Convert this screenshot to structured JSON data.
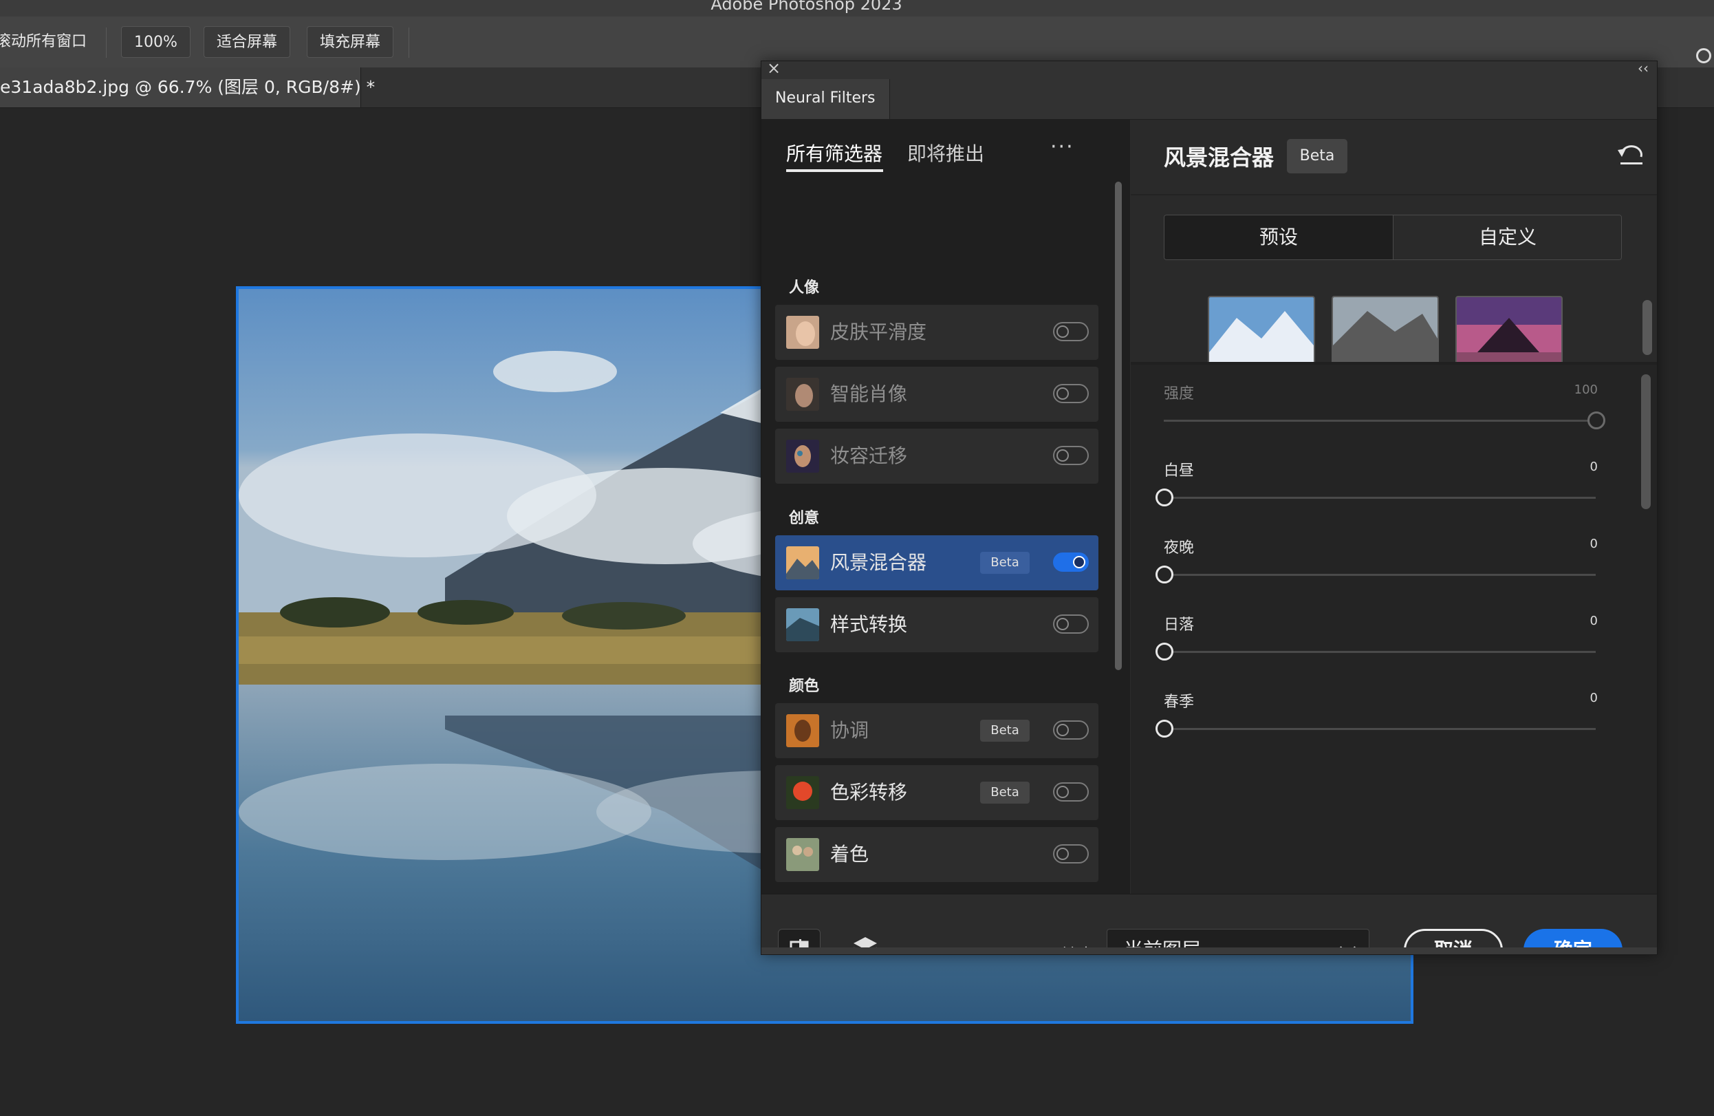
{
  "app": {
    "title": "Adobe Photoshop 2023"
  },
  "options_bar": {
    "scroll_all": "滚动所有窗口",
    "zoom": "100%",
    "fit_screen": "适合屏幕",
    "fill_screen": "填充屏幕"
  },
  "document": {
    "tab_label": "e31ada8b2.jpg @ 66.7% (图层 0, RGB/8#) *"
  },
  "neural_filters": {
    "panel_title": "Neural Filters",
    "close_glyph": "×",
    "collapse_glyph": "‹‹",
    "tabs": {
      "all": "所有筛选器",
      "upcoming": "即将推出",
      "more": "···"
    },
    "categories": [
      {
        "name": "人像",
        "filters": [
          {
            "name": "皮肤平滑度",
            "beta": false,
            "enabled": false,
            "dim": true
          },
          {
            "name": "智能肖像",
            "beta": false,
            "enabled": false,
            "dim": true
          },
          {
            "name": "妆容迁移",
            "beta": false,
            "enabled": false,
            "dim": true
          }
        ]
      },
      {
        "name": "创意",
        "filters": [
          {
            "name": "风景混合器",
            "beta": true,
            "enabled": true,
            "dim": false,
            "active": true
          },
          {
            "name": "样式转换",
            "beta": false,
            "enabled": false,
            "dim": false
          }
        ]
      },
      {
        "name": "颜色",
        "filters": [
          {
            "name": "协调",
            "beta": true,
            "enabled": false,
            "dim": true
          },
          {
            "name": "色彩转移",
            "beta": true,
            "enabled": false,
            "dim": false
          },
          {
            "name": "着色",
            "beta": false,
            "enabled": false,
            "dim": false
          }
        ]
      }
    ],
    "beta_label": "Beta",
    "detail": {
      "title": "风景混合器",
      "beta": "Beta",
      "seg_preset": "预设",
      "seg_custom": "自定义",
      "sliders": [
        {
          "label": "强度",
          "value": "100",
          "fraction": 1.0,
          "dim": true
        },
        {
          "label": "白昼",
          "value": "0",
          "fraction": 0.0,
          "dim": false
        },
        {
          "label": "夜晚",
          "value": "0",
          "fraction": 0.0,
          "dim": false
        },
        {
          "label": "日落",
          "value": "0",
          "fraction": 0.0,
          "dim": false
        },
        {
          "label": "春季",
          "value": "0",
          "fraction": 0.0,
          "dim": false
        }
      ]
    },
    "output": {
      "label": "输出",
      "selected": "当前图层"
    },
    "buttons": {
      "cancel": "取消",
      "ok": "确定"
    }
  },
  "colors": {
    "accent": "#1a73e8",
    "selection_border": "#1f78e0",
    "active_row": "#2a4f8c"
  }
}
